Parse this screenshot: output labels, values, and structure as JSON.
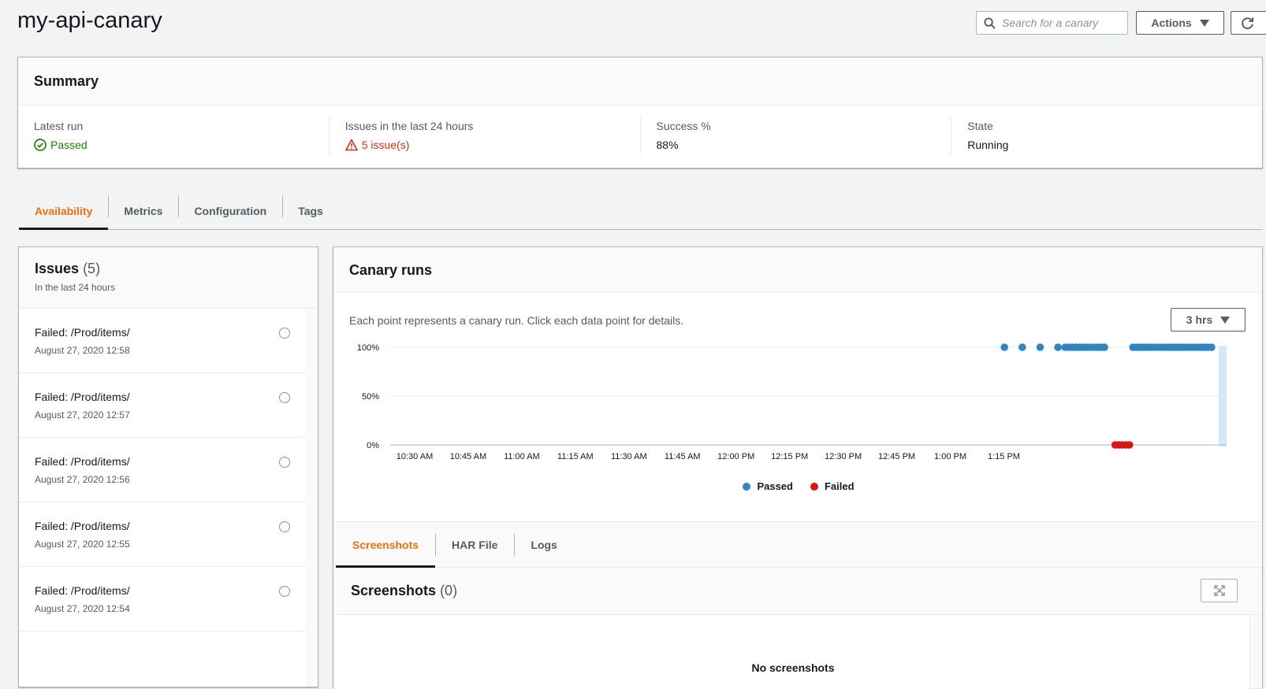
{
  "header": {
    "title": "my-api-canary",
    "search_placeholder": "Search for a canary",
    "actions_label": "Actions"
  },
  "summary": {
    "title": "Summary",
    "latest_run_label": "Latest run",
    "latest_run_value": "Passed",
    "issues_label": "Issues in the last 24 hours",
    "issues_value": "5 issue(s)",
    "success_label": "Success %",
    "success_value": "88%",
    "state_label": "State",
    "state_value": "Running"
  },
  "tabs": [
    {
      "label": "Availability",
      "active": true
    },
    {
      "label": "Metrics"
    },
    {
      "label": "Configuration"
    },
    {
      "label": "Tags"
    }
  ],
  "issues": {
    "title": "Issues",
    "count": "(5)",
    "subtitle": "In the last 24 hours",
    "items": [
      {
        "name": "Failed: /Prod/items/",
        "date": "August 27, 2020 12:58"
      },
      {
        "name": "Failed: /Prod/items/",
        "date": "August 27, 2020 12:57"
      },
      {
        "name": "Failed: /Prod/items/",
        "date": "August 27, 2020 12:56"
      },
      {
        "name": "Failed: /Prod/items/",
        "date": "August 27, 2020 12:55"
      },
      {
        "name": "Failed: /Prod/items/",
        "date": "August 27, 2020 12:54"
      }
    ]
  },
  "canary_runs": {
    "title": "Canary runs",
    "description": "Each point represents a canary run. Click each data point for details.",
    "range_label": "3 hrs",
    "legend_passed": "Passed",
    "legend_failed": "Failed"
  },
  "colors": {
    "accent": "#ec7211",
    "passed": "#3184c2",
    "failed": "#d91515",
    "success_text": "#1d8102",
    "error_text": "#d13212"
  },
  "chart_data": {
    "type": "scatter",
    "xlabel": "",
    "ylabel": "",
    "x_ticks": [
      "10:30 AM",
      "10:45 AM",
      "11:00 AM",
      "11:15 AM",
      "11:30 AM",
      "11:45 AM",
      "12:00 PM",
      "12:15 PM",
      "12:30 PM",
      "12:45 PM",
      "1:00 PM",
      "1:15 PM"
    ],
    "y_ticks": [
      "0%",
      "50%",
      "100%"
    ],
    "x_range_minutes": [
      -30,
      202
    ],
    "y_range": [
      0,
      100
    ],
    "series": [
      {
        "name": "Passed",
        "color": "#3184c2",
        "x": [
          142,
          147,
          152,
          157,
          159,
          160,
          161,
          162,
          163,
          164,
          165,
          166,
          167,
          168,
          169,
          170,
          178,
          179,
          180,
          181,
          182,
          183,
          184,
          185,
          186,
          187,
          188,
          189,
          190,
          191,
          192,
          193,
          194,
          195,
          196,
          197,
          198,
          199,
          200
        ],
        "y": [
          100,
          100,
          100,
          100,
          100,
          100,
          100,
          100,
          100,
          100,
          100,
          100,
          100,
          100,
          100,
          100,
          100,
          100,
          100,
          100,
          100,
          100,
          100,
          100,
          100,
          100,
          100,
          100,
          100,
          100,
          100,
          100,
          100,
          100,
          100,
          100,
          100,
          100,
          100
        ]
      },
      {
        "name": "Failed",
        "color": "#d91515",
        "x": [
          173,
          174,
          175,
          176,
          177
        ],
        "y": [
          0,
          0,
          0,
          0,
          0
        ]
      }
    ]
  },
  "artifacts": {
    "tabs": [
      {
        "label": "Screenshots",
        "active": true
      },
      {
        "label": "HAR File"
      },
      {
        "label": "Logs"
      }
    ],
    "screenshots_title": "Screenshots",
    "screenshots_count": "(0)",
    "empty_text": "No screenshots"
  }
}
